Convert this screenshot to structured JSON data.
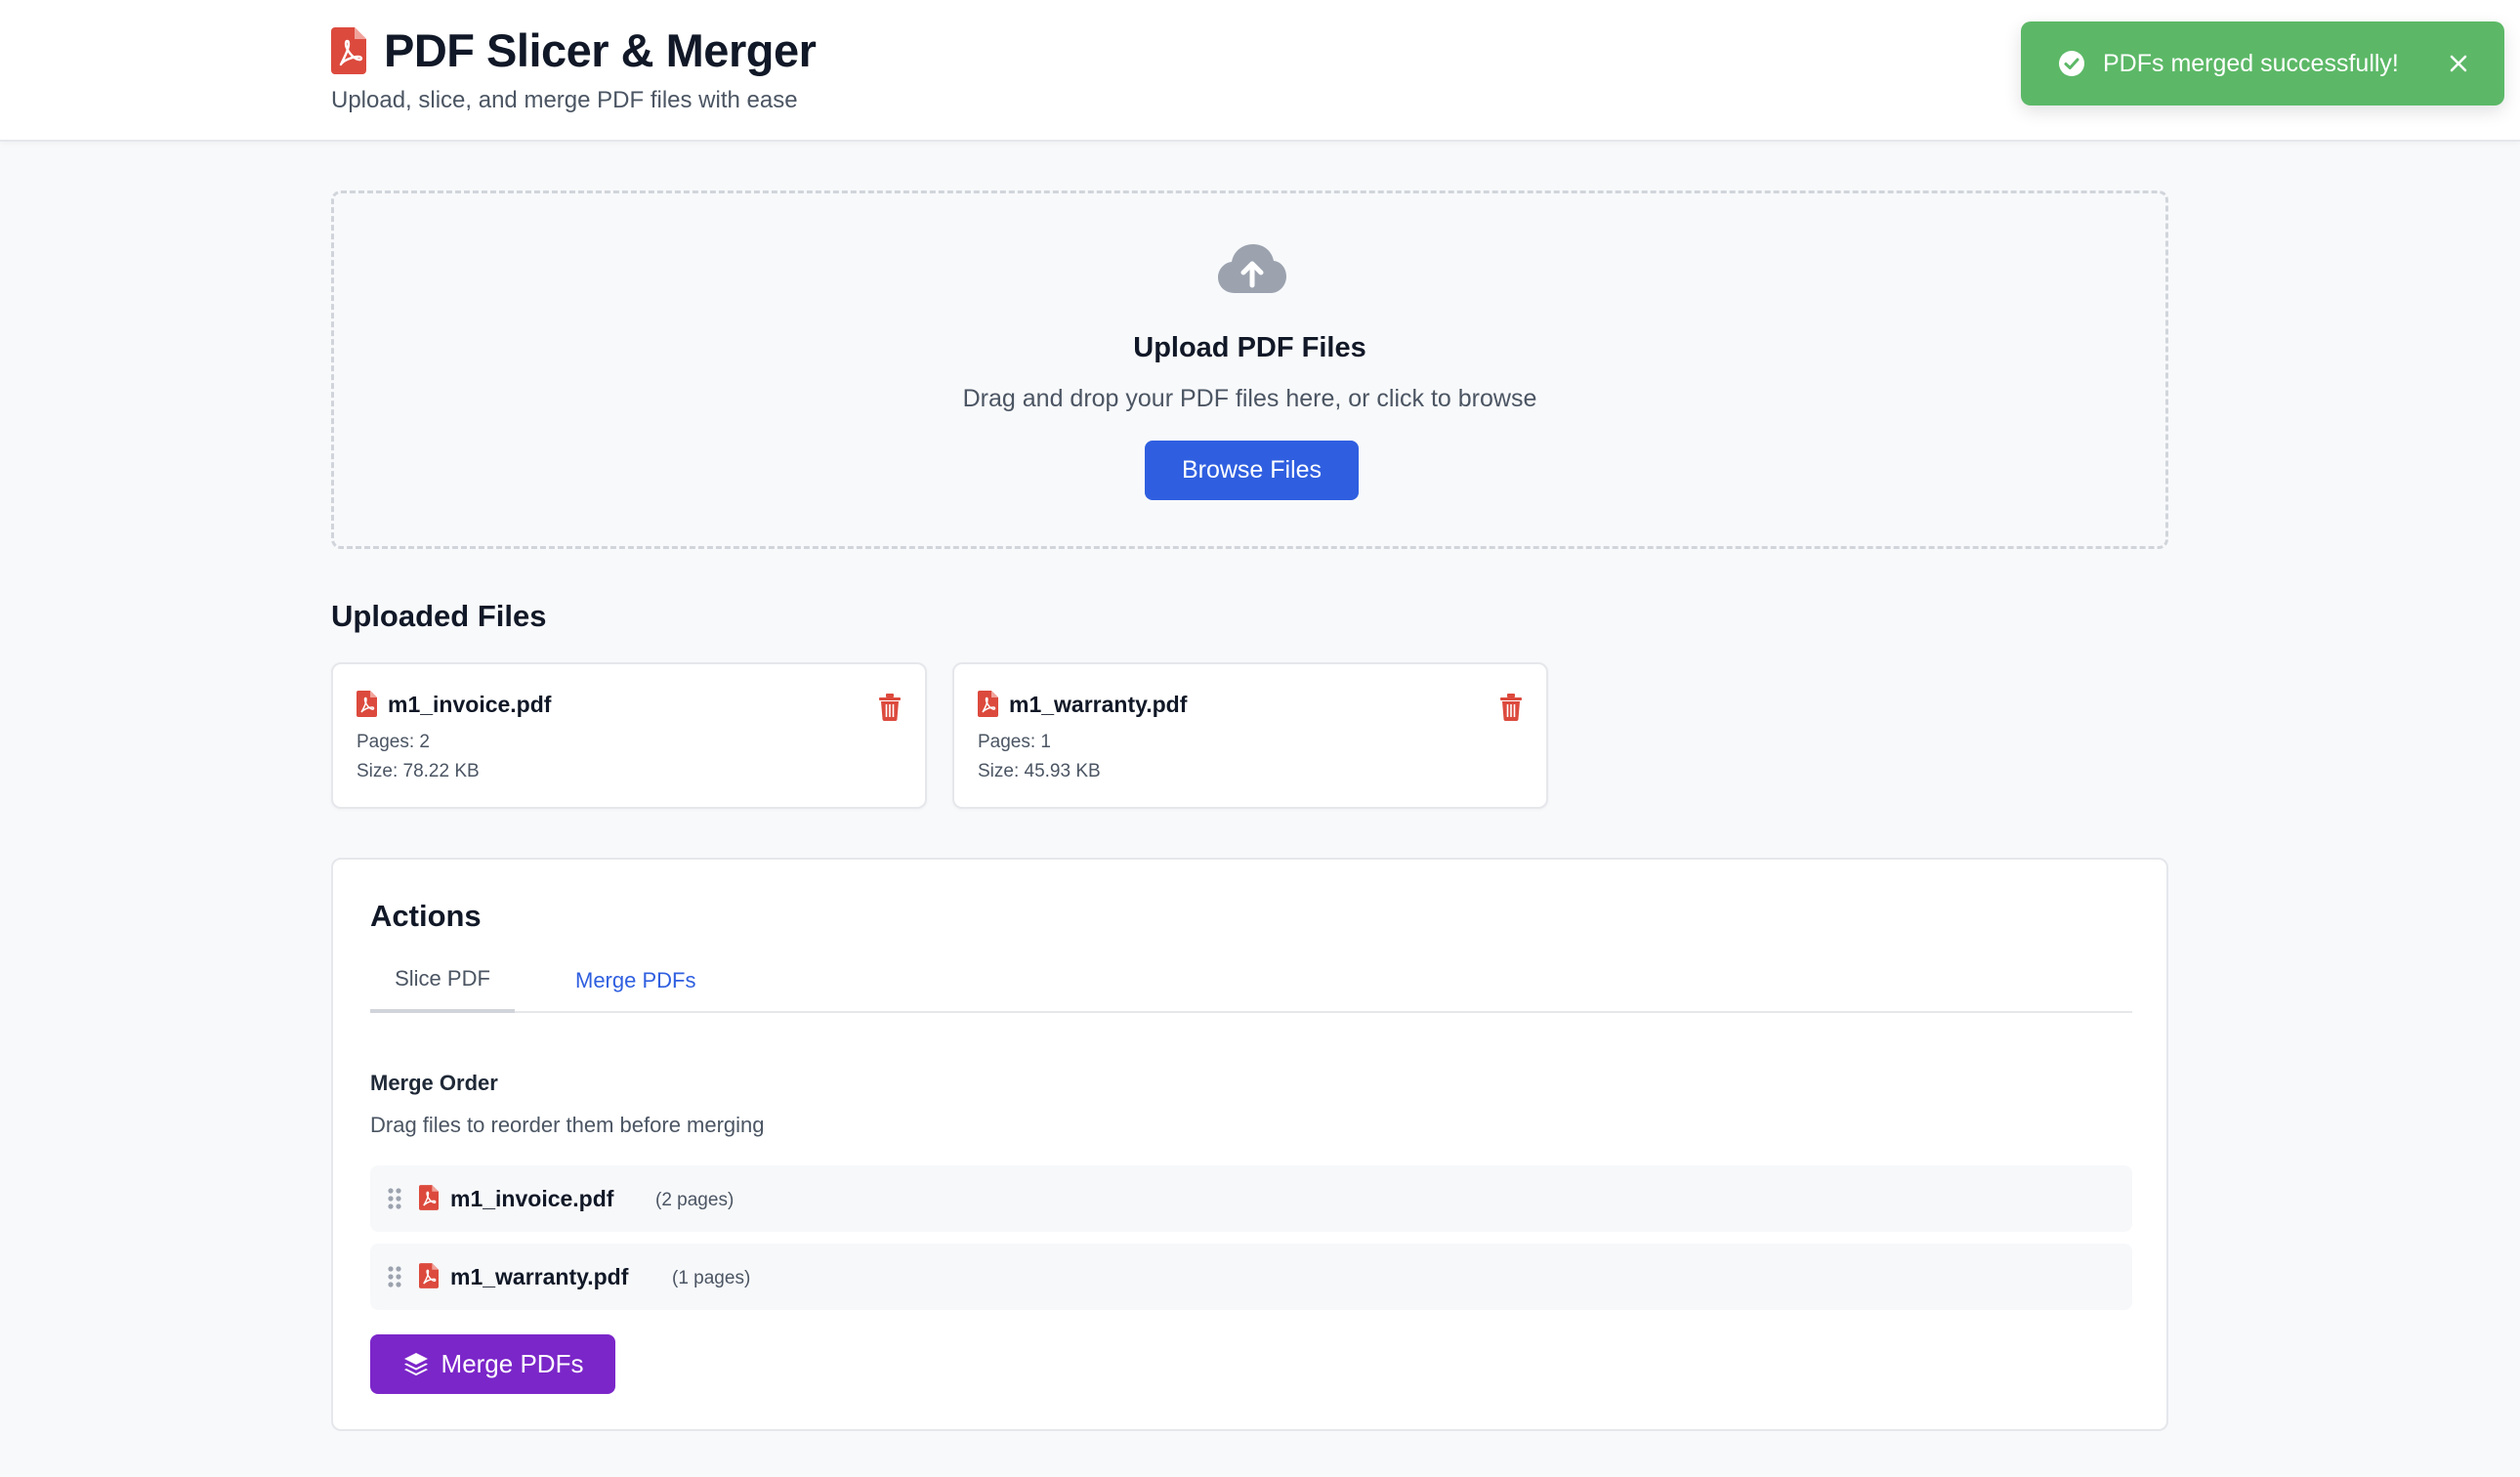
{
  "header": {
    "title": "PDF Slicer & Merger",
    "subtitle": "Upload, slice, and merge PDF files with ease"
  },
  "toast": {
    "message": "PDFs merged successfully!",
    "icon": "check-circle-icon",
    "close_icon": "close-icon"
  },
  "upload": {
    "icon": "cloud-upload-icon",
    "title": "Upload PDF Files",
    "subtitle": "Drag and drop your PDF files here, or click to browse",
    "button_label": "Browse Files"
  },
  "uploaded": {
    "title": "Uploaded Files",
    "files": [
      {
        "name": "m1_invoice.pdf",
        "pages": "Pages: 2",
        "size": "Size: 78.22 KB"
      },
      {
        "name": "m1_warranty.pdf",
        "pages": "Pages: 1",
        "size": "Size: 45.93 KB"
      }
    ]
  },
  "actions": {
    "title": "Actions",
    "tabs": [
      {
        "label": "Slice PDF",
        "active": false
      },
      {
        "label": "Merge PDFs",
        "active": true
      }
    ],
    "merge": {
      "order_label": "Merge Order",
      "hint": "Drag files to reorder them before merging",
      "items": [
        {
          "name": "m1_invoice.pdf",
          "pages": "(2 pages)"
        },
        {
          "name": "m1_warranty.pdf",
          "pages": "(1 pages)"
        }
      ],
      "button_label": "Merge PDFs"
    }
  },
  "colors": {
    "primary": "#2f5fe0",
    "merge": "#7b26c9",
    "success": "#5cb867",
    "pdf_red": "#dc4a3d"
  }
}
